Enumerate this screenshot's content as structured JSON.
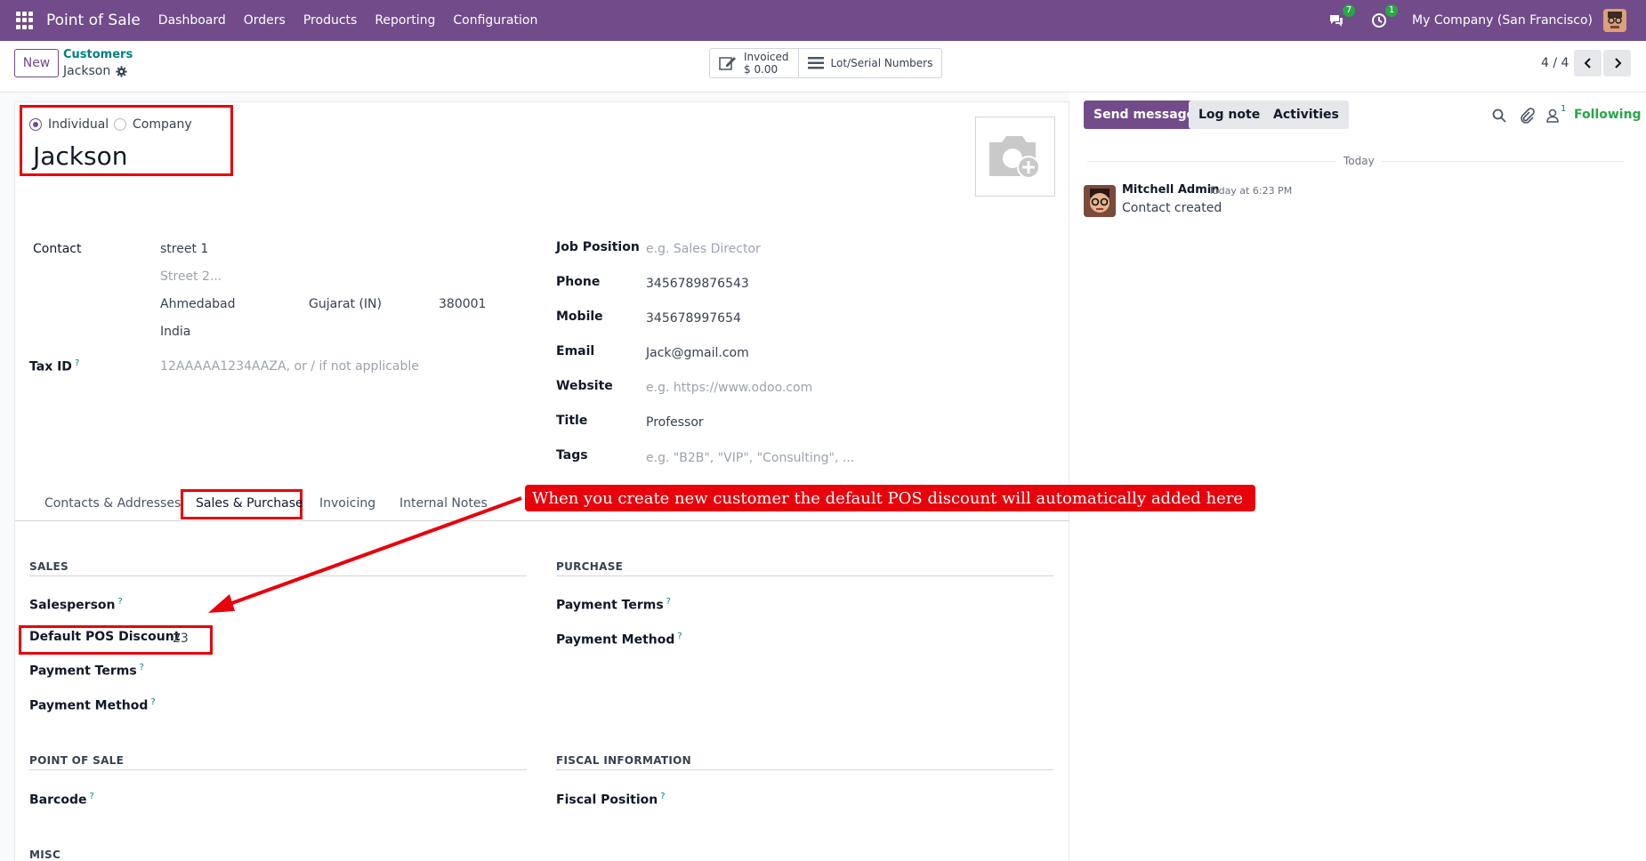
{
  "navbar": {
    "app_name": "Point of Sale",
    "menu": [
      "Dashboard",
      "Orders",
      "Products",
      "Reporting",
      "Configuration"
    ],
    "messages_count": "7",
    "activities_count": "1",
    "company": "My Company (San Francisco)"
  },
  "control": {
    "new_label": "New",
    "breadcrumb_parent": "Customers",
    "breadcrumb_current": "Jackson",
    "invoiced_label": "Invoiced",
    "invoiced_value": "$ 0.00",
    "lot_label": "Lot/Serial Numbers",
    "pager": "4 / 4"
  },
  "form": {
    "type_individual": "Individual",
    "type_company": "Company",
    "name": "Jackson",
    "contact_label": "Contact",
    "street": "street 1",
    "street2_placeholder": "Street 2...",
    "city": "Ahmedabad",
    "state": "Gujarat (IN)",
    "zip": "380001",
    "country": "India",
    "taxid_label": "Tax ID",
    "taxid_placeholder": "12AAAAA1234AAZA, or / if not applicable",
    "job_label": "Job Position",
    "job_placeholder": "e.g. Sales Director",
    "phone_label": "Phone",
    "phone": "3456789876543",
    "mobile_label": "Mobile",
    "mobile": "345678997654",
    "email_label": "Email",
    "email": "Jack@gmail.com",
    "website_label": "Website",
    "website_placeholder": "e.g. https://www.odoo.com",
    "title_label": "Title",
    "title": "Professor",
    "tags_label": "Tags",
    "tags_placeholder": "e.g. \"B2B\", \"VIP\", \"Consulting\", ..."
  },
  "tabs": [
    "Contacts & Addresses",
    "Sales & Purchase",
    "Invoicing",
    "Internal Notes"
  ],
  "sales_purchase": {
    "sales_title": "SALES",
    "salesperson_label": "Salesperson",
    "pos_discount_label": "Default POS Discount",
    "pos_discount_value": "23",
    "payment_terms_label": "Payment Terms",
    "payment_method_label": "Payment Method",
    "purchase_title": "PURCHASE",
    "p_payment_terms_label": "Payment Terms",
    "p_payment_method_label": "Payment Method",
    "pos_title": "POINT OF SALE",
    "barcode_label": "Barcode",
    "fiscal_title": "FISCAL INFORMATION",
    "fiscal_position_label": "Fiscal Position",
    "misc_title": "MISC"
  },
  "chatter": {
    "send_message": "Send message",
    "log_note": "Log note",
    "activities": "Activities",
    "followers_count": "1",
    "following": "Following",
    "today": "Today",
    "author": "Mitchell Admin",
    "time": "Today at 6:23 PM",
    "message": "Contact created"
  },
  "annotation": {
    "text": "When you create new customer the default POS discount will automatically added here"
  },
  "colors": {
    "brand": "#714b8a",
    "link": "#017e84",
    "success": "#28a745",
    "annotation": "#e8000b"
  }
}
